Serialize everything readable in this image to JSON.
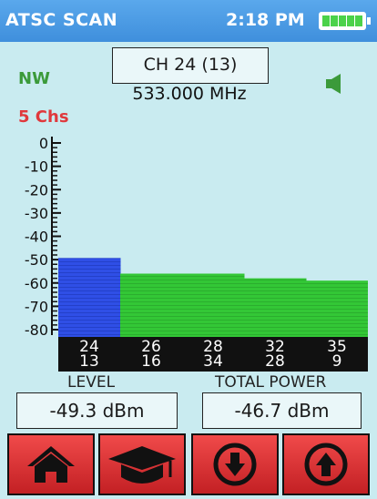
{
  "status": {
    "title": "ATSC SCAN",
    "time": "2:18 PM",
    "battery_level": 1.0
  },
  "channel": {
    "label": "CH 24 (13)",
    "frequency": "533.000 MHz"
  },
  "direction": "NW",
  "channel_count": "5 Chs",
  "chart_data": {
    "type": "bar",
    "y_ticks": [
      "0",
      "-10",
      "-20",
      "-30",
      "-40",
      "-50",
      "-60",
      "-70",
      "-80"
    ],
    "ylim": [
      -80,
      0
    ],
    "categories": [
      {
        "rf": "24",
        "virtual": "13"
      },
      {
        "rf": "26",
        "virtual": "16"
      },
      {
        "rf": "28",
        "virtual": "34"
      },
      {
        "rf": "32",
        "virtual": "28"
      },
      {
        "rf": "35",
        "virtual": "9"
      }
    ],
    "values": [
      -49.3,
      -56,
      -56,
      -58,
      -59
    ],
    "selected_index": 0,
    "colors": {
      "selected": "#2f4fe6",
      "other": "#33c736"
    }
  },
  "readouts": {
    "level_title": "LEVEL",
    "level_value": "-49.3 dBm",
    "power_title": "TOTAL POWER",
    "power_value": "-46.7 dBm"
  },
  "buttons": {
    "home": "home-icon",
    "learn": "graduation-cap-icon",
    "down": "arrow-down-circle-icon",
    "up": "arrow-up-circle-icon"
  }
}
